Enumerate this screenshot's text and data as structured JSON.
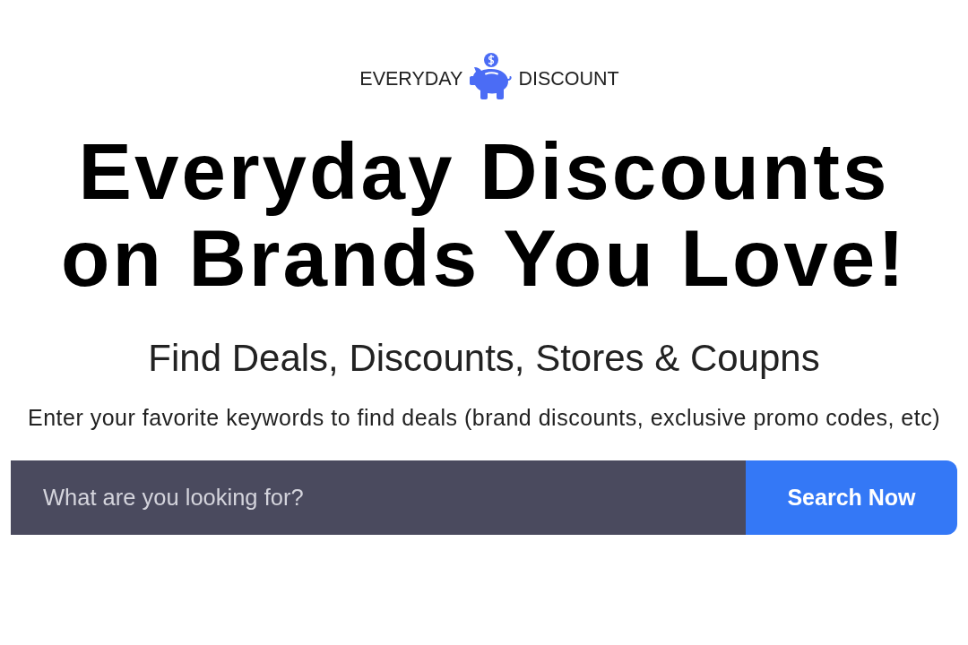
{
  "logo": {
    "left_text": "EVERYDAY",
    "right_text": "DISCOUNT"
  },
  "headline": "Everyday Discounts on Brands You Love!",
  "subtitle": "Find Deals, Discounts, Stores & Coupns",
  "description": "Enter your favorite keywords to find deals (brand discounts, exclusive promo codes, etc)",
  "search": {
    "placeholder": "What are you looking for?",
    "button": "Search Now"
  }
}
